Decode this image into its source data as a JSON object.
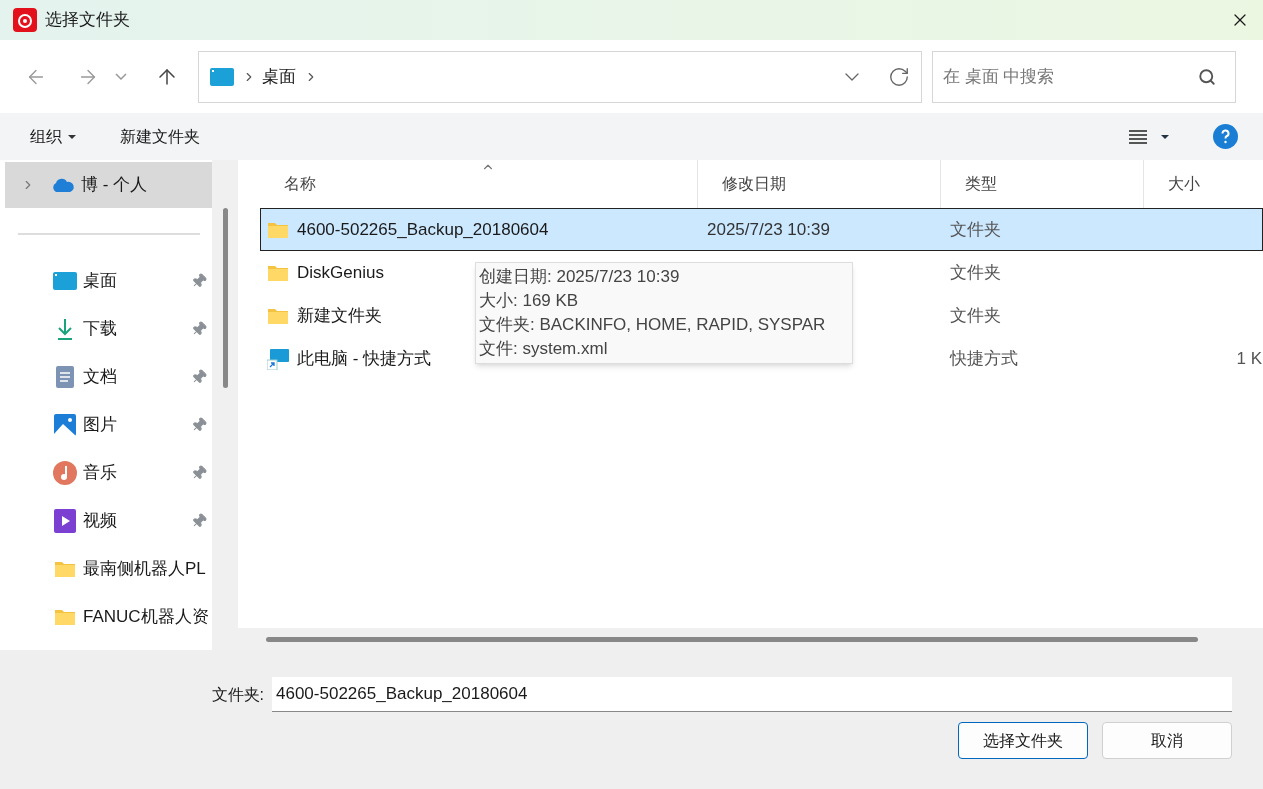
{
  "window": {
    "title": "选择文件夹"
  },
  "nav": {
    "breadcrumb": [
      {
        "label": "桌面"
      }
    ],
    "search": {
      "placeholder": "在 桌面 中搜索"
    }
  },
  "toolbar": {
    "organize": "组织",
    "new_folder": "新建文件夹"
  },
  "sidebar": {
    "account": {
      "label": "博 - 个人",
      "expanded": false,
      "selected": true
    },
    "items": [
      {
        "label": "桌面",
        "kind": "desktop",
        "pinned": true
      },
      {
        "label": "下载",
        "kind": "download",
        "pinned": true
      },
      {
        "label": "文档",
        "kind": "document",
        "pinned": true
      },
      {
        "label": "图片",
        "kind": "picture",
        "pinned": true
      },
      {
        "label": "音乐",
        "kind": "music",
        "pinned": true
      },
      {
        "label": "视频",
        "kind": "video",
        "pinned": true
      },
      {
        "label": "最南侧机器人PL",
        "kind": "folder",
        "pinned": false
      },
      {
        "label": "FANUC机器人资",
        "kind": "folder",
        "pinned": false
      }
    ]
  },
  "table": {
    "columns": [
      {
        "label": "名称",
        "sorted": true
      },
      {
        "label": "修改日期",
        "sorted": false
      },
      {
        "label": "类型",
        "sorted": false
      },
      {
        "label": "大小",
        "sorted": false
      }
    ],
    "rows": [
      {
        "name": "4600-502265_Backup_20180604",
        "kind": "folder",
        "date": "2025/7/23 10:39",
        "type": "文件夹",
        "selected": true
      },
      {
        "name": "DiskGenius",
        "kind": "folder",
        "type": "文件夹",
        "selected": false
      },
      {
        "name": "新建文件夹",
        "kind": "folder",
        "type": "文件夹",
        "selected": false
      },
      {
        "name": "此电脑 - 快捷方式",
        "kind": "shortcut",
        "type": "快捷方式",
        "size": "1 K",
        "selected": false
      }
    ]
  },
  "tooltip": {
    "lines": [
      "创建日期: 2025/7/23 10:39",
      "大小: 169 KB",
      "文件夹: BACKINFO, HOME, RAPID, SYSPAR",
      "文件: system.xml"
    ]
  },
  "footer": {
    "label": "文件夹:",
    "value": "4600-502265_Backup_20180604",
    "buttons": [
      {
        "label": "选择文件夹",
        "primary": true
      },
      {
        "label": "取消",
        "primary": false
      }
    ]
  }
}
